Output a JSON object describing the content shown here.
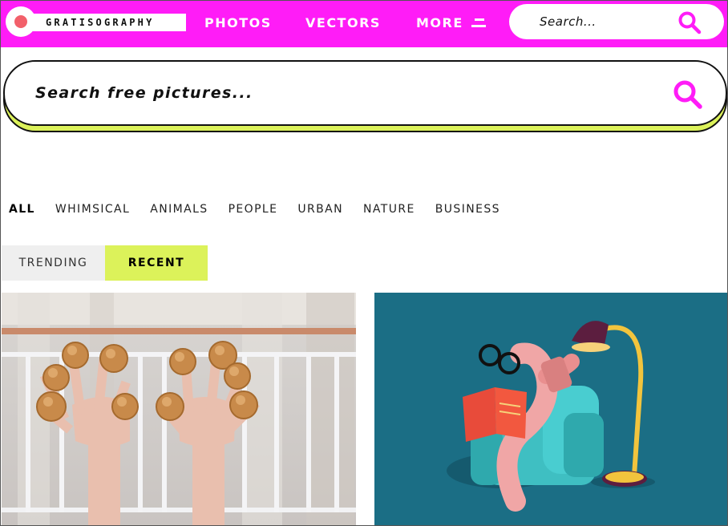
{
  "header": {
    "logo_text": "GRATISOGRAPHY",
    "nav": {
      "photos": "PHOTOS",
      "vectors": "VECTORS",
      "more": "MORE"
    },
    "search_placeholder": "Search...",
    "background_color": "#ff1cf7"
  },
  "main_search": {
    "placeholder": "Search free pictures...",
    "accent_color": "#dcf25a"
  },
  "categories": [
    "ALL",
    "WHIMSICAL",
    "ANIMALS",
    "PEOPLE",
    "URBAN",
    "NATURE",
    "BUSINESS"
  ],
  "active_category": "ALL",
  "sort_tabs": {
    "trending": "TRENDING",
    "recent": "RECENT",
    "active": "RECENT"
  },
  "gallery": [
    {
      "subject": "hands with cream puffs on fingertips",
      "type": "photo"
    },
    {
      "subject": "pink worm with glasses reading a book in armchair under lamp",
      "type": "vector"
    }
  ],
  "icons": [
    "search-icon",
    "menu-icon",
    "logo-dot-icon"
  ]
}
